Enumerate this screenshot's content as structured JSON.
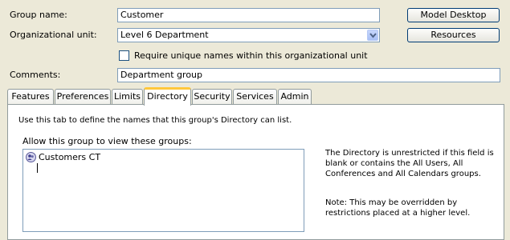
{
  "form": {
    "group_name_label": "Group name:",
    "group_name_value": "Customer",
    "org_unit_label": "Organizational unit:",
    "org_unit_value": "Level 6 Department",
    "require_unique_label": "Require unique names within this organizational unit",
    "require_unique_checked": false,
    "comments_label": "Comments:",
    "comments_value": "Department group"
  },
  "buttons": {
    "model_desktop": "Model Desktop",
    "resources": "Resources"
  },
  "tabs": [
    {
      "label": "Features"
    },
    {
      "label": "Preferences"
    },
    {
      "label": "Limits"
    },
    {
      "label": "Directory",
      "active": true
    },
    {
      "label": "Security"
    },
    {
      "label": "Services"
    },
    {
      "label": "Admin"
    }
  ],
  "directory": {
    "description": "Use this tab to define the names that this group's Directory can list.",
    "allow_label": "Allow this group to view these groups:",
    "groups": [
      {
        "name": "Customers CT",
        "icon": "group-icon"
      }
    ],
    "info_unrestricted_1": "The Directory is unrestricted if this field is",
    "info_unrestricted_2": "blank or contains the All Users, All",
    "info_unrestricted_3": "Conferences and All Calendars groups.",
    "info_note_1": "Note: This may be overridden by",
    "info_note_2": "restrictions placed at a higher level."
  },
  "colors": {
    "window_bg": "#ece9d8",
    "active_tab_accent": "#ffc83c",
    "field_border": "#7f9db9"
  }
}
